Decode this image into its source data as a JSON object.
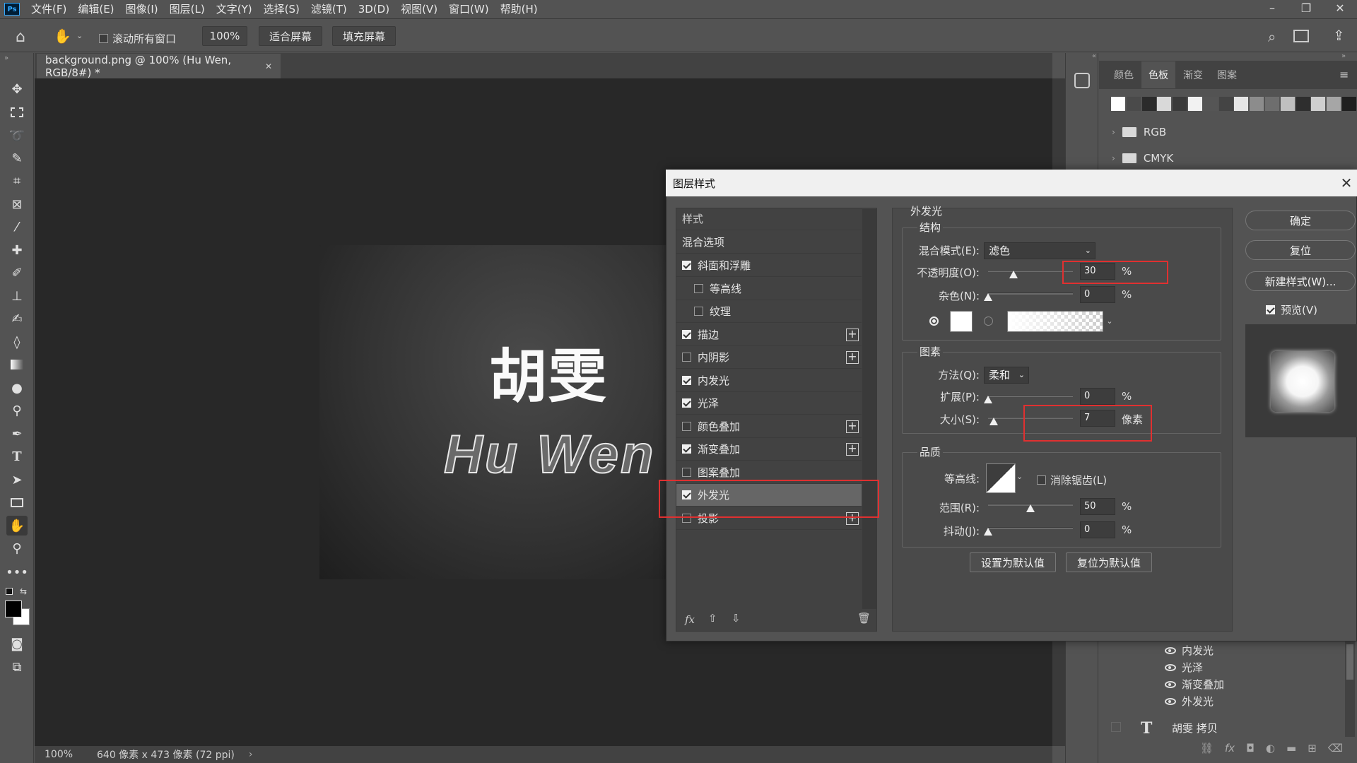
{
  "app": {
    "logo": "Ps"
  },
  "menu": [
    "文件(F)",
    "编辑(E)",
    "图像(I)",
    "图层(L)",
    "文字(Y)",
    "选择(S)",
    "滤镜(T)",
    "3D(D)",
    "视图(V)",
    "窗口(W)",
    "帮助(H)"
  ],
  "options": {
    "scroll_all": "滚动所有窗口",
    "zoom": "100%",
    "fit_screen": "适合屏幕",
    "fill_screen": "填充屏幕"
  },
  "document": {
    "tab_title": "background.png @ 100% (Hu Wen, RGB/8#) *",
    "text_cn": "胡雯",
    "text_en": "Hu Wen"
  },
  "status": {
    "zoom": "100%",
    "info": "640 像素 x 473 像素 (72 ppi)"
  },
  "panels": {
    "tabs": [
      "颜色",
      "色板",
      "渐变",
      "图案"
    ],
    "active_tab": "色板",
    "swatch_colors": [
      "#ffffff",
      "#4a4a4a",
      "#2b2b2b",
      "#d9d9d9",
      "#3a3a3a",
      "#f2f2f2",
      "#555555",
      "#444444",
      "#e6e6e6",
      "#8c8c8c",
      "#6e6e6e",
      "#bfbfbf",
      "#2e2e2e",
      "#cfcfcf",
      "#a6a6a6",
      "#1f1f1f"
    ],
    "folders": [
      "RGB",
      "CMYK"
    ],
    "layer_effects": [
      "内发光",
      "光泽",
      "渐变叠加",
      "外发光"
    ],
    "layer_name": "胡雯 拷贝"
  },
  "dialog": {
    "title": "图层样式",
    "styles_header": "样式",
    "blend_options": "混合选项",
    "style_items": [
      {
        "label": "斜面和浮雕",
        "checked": true,
        "plus": false
      },
      {
        "label": "等高线",
        "checked": false,
        "plus": false
      },
      {
        "label": "纹理",
        "checked": false,
        "plus": false
      },
      {
        "label": "描边",
        "checked": true,
        "plus": true
      },
      {
        "label": "内阴影",
        "checked": false,
        "plus": true
      },
      {
        "label": "内发光",
        "checked": true,
        "plus": false
      },
      {
        "label": "光泽",
        "checked": true,
        "plus": false
      },
      {
        "label": "颜色叠加",
        "checked": false,
        "plus": true
      },
      {
        "label": "渐变叠加",
        "checked": true,
        "plus": true
      },
      {
        "label": "图案叠加",
        "checked": false,
        "plus": false
      },
      {
        "label": "外发光",
        "checked": true,
        "plus": false
      },
      {
        "label": "投影",
        "checked": false,
        "plus": true
      }
    ],
    "fx_label": "fx",
    "section_title": "外发光",
    "structure": {
      "title": "结构",
      "blend_mode_label": "混合模式(E):",
      "blend_mode": "滤色",
      "opacity_label": "不透明度(O):",
      "opacity": "30",
      "noise_label": "杂色(N):",
      "noise": "0",
      "pct": "%"
    },
    "elements": {
      "title": "图素",
      "technique_label": "方法(Q):",
      "technique": "柔和",
      "spread_label": "扩展(P):",
      "spread": "0",
      "size_label": "大小(S):",
      "size": "7",
      "size_unit": "像素"
    },
    "quality": {
      "title": "品质",
      "contour_label": "等高线:",
      "antialias_label": "消除锯齿(L)",
      "range_label": "范围(R):",
      "range": "50",
      "jitter_label": "抖动(J):",
      "jitter": "0"
    },
    "set_default": "设置为默认值",
    "reset_default": "复位为默认值",
    "ok": "确定",
    "reset": "复位",
    "new_style": "新建样式(W)...",
    "preview_label": "预览(V)"
  }
}
